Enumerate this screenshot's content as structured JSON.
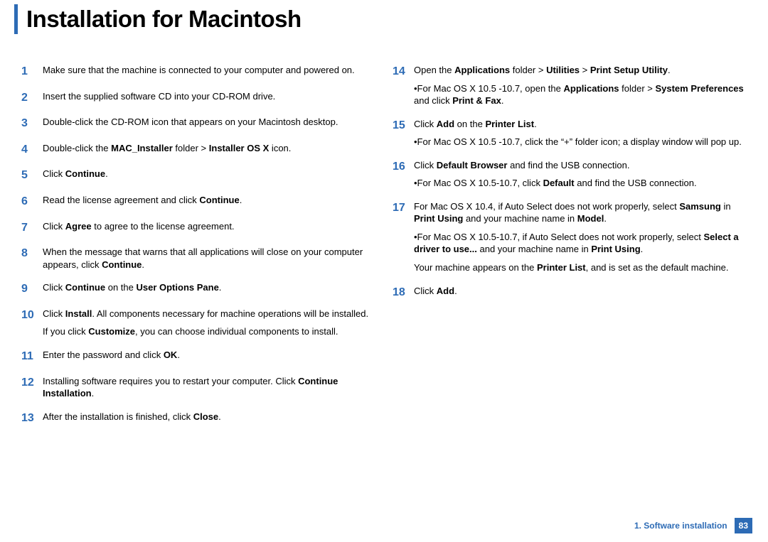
{
  "title": "Installation for Macintosh",
  "footer": {
    "chapter": "1.  Software installation",
    "page": "83"
  },
  "left": [
    {
      "n": "1",
      "body": [
        "Make sure that the machine is connected to your computer and powered on."
      ]
    },
    {
      "n": "2",
      "body": [
        "Insert the supplied software CD into your CD-ROM drive."
      ]
    },
    {
      "n": "3",
      "body": [
        "Double-click the CD-ROM icon that appears on your Macintosh desktop."
      ]
    },
    {
      "n": "4",
      "body": [
        "Double-click the <b>MAC_Installer</b> folder > <b>Installer OS X</b> icon."
      ]
    },
    {
      "n": "5",
      "body": [
        "Click <b>Continue</b>."
      ]
    },
    {
      "n": "6",
      "body": [
        "Read the license agreement and click <b>Continue</b>."
      ]
    },
    {
      "n": "7",
      "body": [
        "Click <b>Agree</b> to agree to the license agreement."
      ]
    },
    {
      "n": "8",
      "body": [
        "When the message that warns that all applications will close on your computer appears, click <b>Continue</b>."
      ]
    },
    {
      "n": "9",
      "body": [
        "Click <b>Continue</b> on the <b>User Options Pane</b>."
      ]
    },
    {
      "n": "10",
      "body": [
        "Click <b>Install</b>. All components necessary for machine operations will be installed.",
        "If you click <b>Customize</b>, you can choose individual components to install."
      ]
    },
    {
      "n": "11",
      "body": [
        "Enter the password and click <b>OK</b>."
      ]
    },
    {
      "n": "12",
      "body": [
        "Installing software requires you to restart your computer. Click <b>Continue Installation</b>."
      ]
    },
    {
      "n": "13",
      "body": [
        "After the installation is finished, click <b>Close</b>."
      ]
    }
  ],
  "right": [
    {
      "n": "14",
      "body": [
        "Open the <b>Applications</b> folder > <b>Utilities</b> > <b>Print Setup Utility</b>.",
        "•For Mac OS X 10.5 -10.7, open the <b>Applications</b> folder > <b>System Preferences</b> and click <b>Print & Fax</b>."
      ]
    },
    {
      "n": "15",
      "body": [
        "Click <b>Add</b> on the <b>Printer List</b>.",
        "•For Mac OS X 10.5 -10.7, click the “+” folder icon; a display window will pop up."
      ]
    },
    {
      "n": "16",
      "body": [
        "Click <b>Default Browser</b> and find the USB connection.",
        "•For Mac OS X 10.5-10.7, click <b>Default</b> and find the USB connection."
      ]
    },
    {
      "n": "17",
      "body": [
        "For Mac OS X 10.4, if Auto Select does not work properly, select <b>Samsung</b> in <b>Print Using</b> and your machine name in <b>Model</b>.",
        "•For Mac OS X 10.5-10.7, if Auto Select does not work properly, select <b>Select a driver to use...</b> and your machine name in <b>Print Using</b>.",
        "Your machine appears on the <b>Printer List</b>, and is set as the default machine."
      ]
    },
    {
      "n": "18",
      "body": [
        "Click <b>Add</b>."
      ]
    }
  ]
}
